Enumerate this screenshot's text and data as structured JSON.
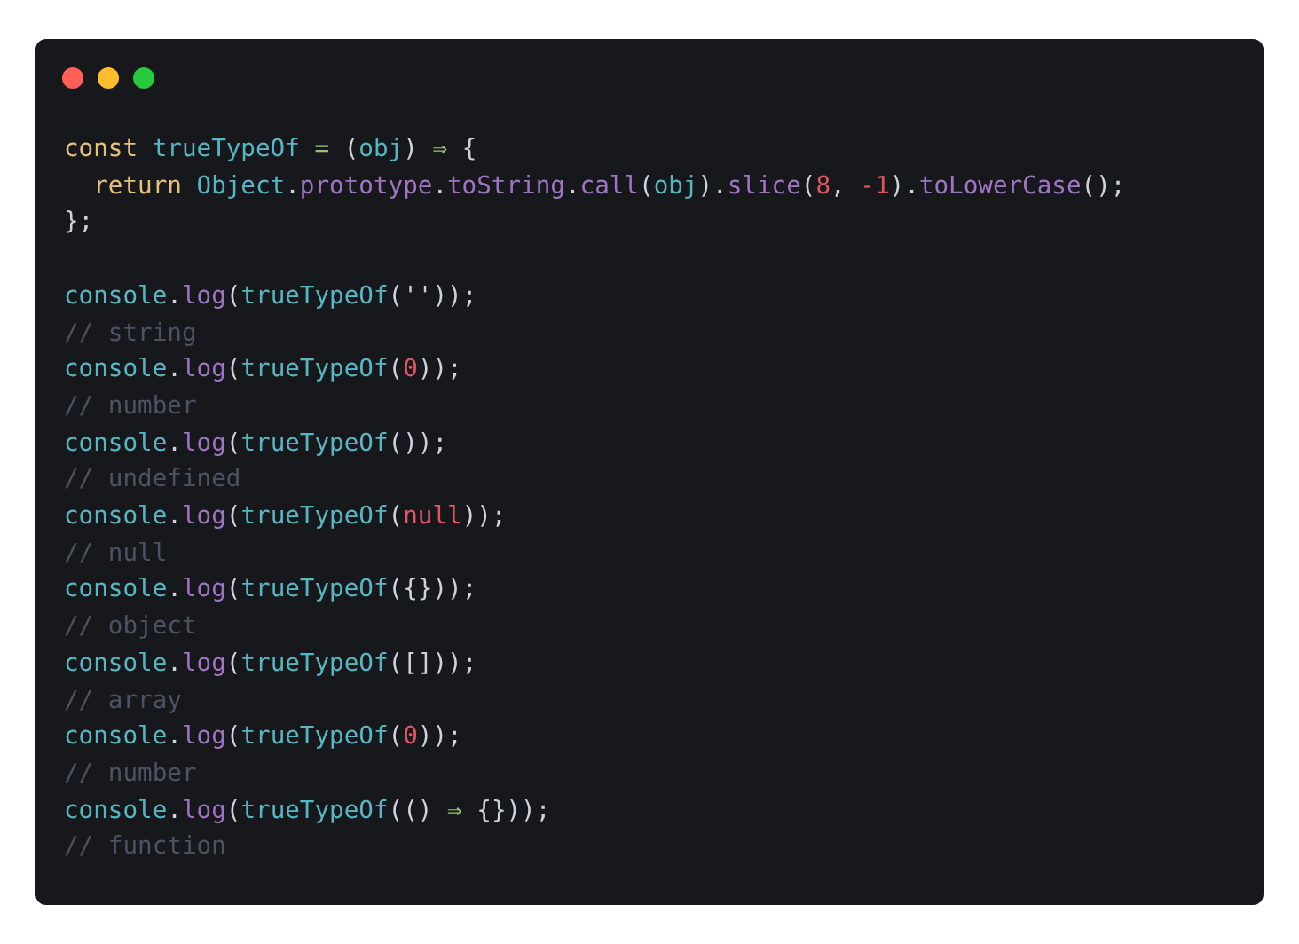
{
  "window": {
    "controls": [
      {
        "color": "#ff5f56"
      },
      {
        "color": "#ffbd2e"
      },
      {
        "color": "#27c93f"
      }
    ]
  },
  "code_blocks": [
    {
      "lines": [
        [
          {
            "text": "const ",
            "kind": "keyword"
          },
          {
            "text": "trueTypeOf",
            "kind": "name"
          },
          {
            "text": " =",
            "kind": "operator"
          },
          {
            "text": " (",
            "kind": "plain"
          },
          {
            "text": "obj",
            "kind": "name"
          },
          {
            "text": ") ",
            "kind": "plain"
          },
          {
            "text": "⇒",
            "kind": "operator"
          },
          {
            "text": " {",
            "kind": "plain"
          }
        ],
        [
          {
            "text": "  return ",
            "kind": "keyword"
          },
          {
            "text": "Object",
            "kind": "name"
          },
          {
            "text": ".",
            "kind": "plain"
          },
          {
            "text": "prototype",
            "kind": "property"
          },
          {
            "text": ".",
            "kind": "plain"
          },
          {
            "text": "toString",
            "kind": "property"
          },
          {
            "text": ".",
            "kind": "plain"
          },
          {
            "text": "call",
            "kind": "property"
          },
          {
            "text": "(",
            "kind": "plain"
          },
          {
            "text": "obj",
            "kind": "name"
          },
          {
            "text": ").",
            "kind": "plain"
          },
          {
            "text": "slice",
            "kind": "property"
          },
          {
            "text": "(",
            "kind": "plain"
          },
          {
            "text": "8",
            "kind": "number"
          },
          {
            "text": ", ",
            "kind": "plain"
          },
          {
            "text": "-1",
            "kind": "number"
          },
          {
            "text": ").",
            "kind": "plain"
          },
          {
            "text": "toLowerCase",
            "kind": "property"
          },
          {
            "text": "();",
            "kind": "plain"
          }
        ],
        [
          {
            "text": "};",
            "kind": "plain"
          }
        ]
      ]
    },
    {
      "lines": [
        [
          {
            "text": "console",
            "kind": "name"
          },
          {
            "text": ".",
            "kind": "plain"
          },
          {
            "text": "log",
            "kind": "property"
          },
          {
            "text": "(",
            "kind": "plain"
          },
          {
            "text": "trueTypeOf",
            "kind": "name"
          },
          {
            "text": "(''));",
            "kind": "plain"
          }
        ],
        [
          {
            "text": "// string",
            "kind": "comment"
          }
        ],
        [
          {
            "text": "console",
            "kind": "name"
          },
          {
            "text": ".",
            "kind": "plain"
          },
          {
            "text": "log",
            "kind": "property"
          },
          {
            "text": "(",
            "kind": "plain"
          },
          {
            "text": "trueTypeOf",
            "kind": "name"
          },
          {
            "text": "(",
            "kind": "plain"
          },
          {
            "text": "0",
            "kind": "number"
          },
          {
            "text": "));",
            "kind": "plain"
          }
        ],
        [
          {
            "text": "// number",
            "kind": "comment"
          }
        ],
        [
          {
            "text": "console",
            "kind": "name"
          },
          {
            "text": ".",
            "kind": "plain"
          },
          {
            "text": "log",
            "kind": "property"
          },
          {
            "text": "(",
            "kind": "plain"
          },
          {
            "text": "trueTypeOf",
            "kind": "name"
          },
          {
            "text": "());",
            "kind": "plain"
          }
        ],
        [
          {
            "text": "// undefined",
            "kind": "comment"
          }
        ],
        [
          {
            "text": "console",
            "kind": "name"
          },
          {
            "text": ".",
            "kind": "plain"
          },
          {
            "text": "log",
            "kind": "property"
          },
          {
            "text": "(",
            "kind": "plain"
          },
          {
            "text": "trueTypeOf",
            "kind": "name"
          },
          {
            "text": "(",
            "kind": "plain"
          },
          {
            "text": "null",
            "kind": "number"
          },
          {
            "text": "));",
            "kind": "plain"
          }
        ],
        [
          {
            "text": "// null",
            "kind": "comment"
          }
        ],
        [
          {
            "text": "console",
            "kind": "name"
          },
          {
            "text": ".",
            "kind": "plain"
          },
          {
            "text": "log",
            "kind": "property"
          },
          {
            "text": "(",
            "kind": "plain"
          },
          {
            "text": "trueTypeOf",
            "kind": "name"
          },
          {
            "text": "({}));",
            "kind": "plain"
          }
        ],
        [
          {
            "text": "// object",
            "kind": "comment"
          }
        ],
        [
          {
            "text": "console",
            "kind": "name"
          },
          {
            "text": ".",
            "kind": "plain"
          },
          {
            "text": "log",
            "kind": "property"
          },
          {
            "text": "(",
            "kind": "plain"
          },
          {
            "text": "trueTypeOf",
            "kind": "name"
          },
          {
            "text": "([]));",
            "kind": "plain"
          }
        ],
        [
          {
            "text": "// array",
            "kind": "comment"
          }
        ],
        [
          {
            "text": "console",
            "kind": "name"
          },
          {
            "text": ".",
            "kind": "plain"
          },
          {
            "text": "log",
            "kind": "property"
          },
          {
            "text": "(",
            "kind": "plain"
          },
          {
            "text": "trueTypeOf",
            "kind": "name"
          },
          {
            "text": "(",
            "kind": "plain"
          },
          {
            "text": "0",
            "kind": "number"
          },
          {
            "text": "));",
            "kind": "plain"
          }
        ],
        [
          {
            "text": "// number",
            "kind": "comment"
          }
        ],
        [
          {
            "text": "console",
            "kind": "name"
          },
          {
            "text": ".",
            "kind": "plain"
          },
          {
            "text": "log",
            "kind": "property"
          },
          {
            "text": "(",
            "kind": "plain"
          },
          {
            "text": "trueTypeOf",
            "kind": "name"
          },
          {
            "text": "(() ",
            "kind": "plain"
          },
          {
            "text": "⇒",
            "kind": "operator"
          },
          {
            "text": " {}));",
            "kind": "plain"
          }
        ],
        [
          {
            "text": "// function",
            "kind": "comment"
          }
        ]
      ]
    }
  ]
}
